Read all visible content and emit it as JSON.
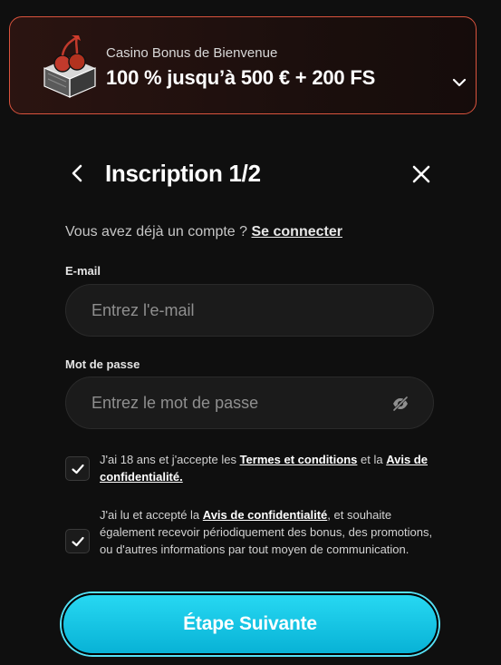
{
  "bonus": {
    "subtitle": "Casino Bonus de Bienvenue",
    "title": "100 % jusqu’à 500 € + 200 FS",
    "icon": "gift-box-icon",
    "accent_color": "#d9533d"
  },
  "header": {
    "title": "Inscription 1/2",
    "back_icon": "chevron-left-icon",
    "close_icon": "close-icon"
  },
  "login_prompt": {
    "text": "Vous avez déjà un compte ?",
    "link": "Se connecter"
  },
  "form": {
    "email": {
      "label": "E-mail",
      "placeholder": "Entrez l'e-mail",
      "value": ""
    },
    "password": {
      "label": "Mot de passe",
      "placeholder": "Entrez le mot de passe",
      "value": "",
      "toggle_icon": "eye-off-icon"
    }
  },
  "consents": [
    {
      "checked": true,
      "text_before": "J'ai 18 ans et j'accepte les",
      "link1": "Termes et conditions",
      "text_middle": "et la",
      "link2": "Avis de confidentialité."
    },
    {
      "checked": true,
      "text_before": "J'ai lu et accepté la",
      "link1": "Avis de confidentialité",
      "text_after": ", et souhaite également recevoir périodiquement des bonus, des promotions, ou d'autres informations par tout moyen de communication."
    }
  ],
  "next_button": {
    "label": "Étape Suivante",
    "color": "#12c4e4"
  }
}
